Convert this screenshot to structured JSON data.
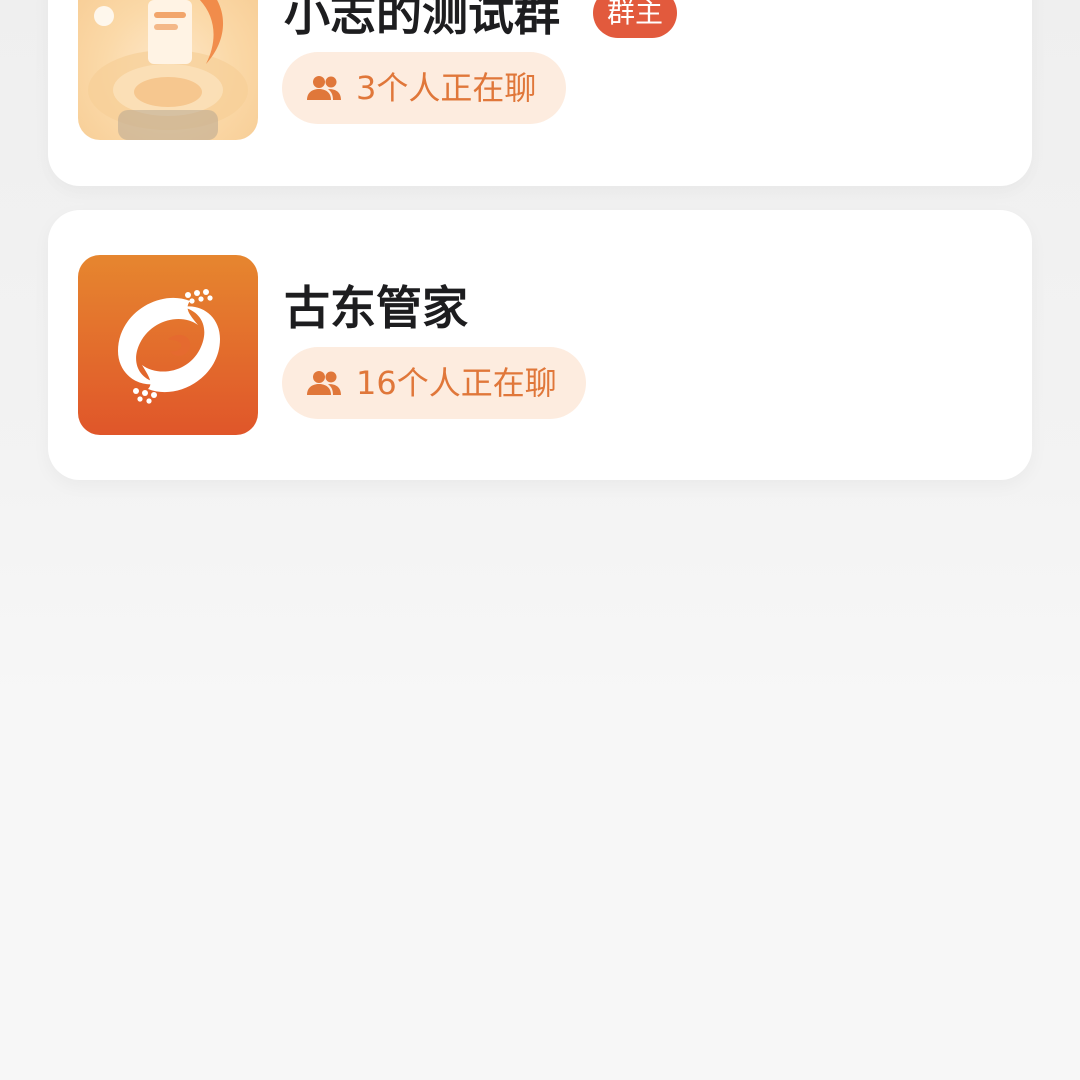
{
  "groups": [
    {
      "name": "小志的测试群",
      "badge": "群主",
      "chat_status": "3个人正在聊",
      "avatar_icon": "illustrated-group-avatar"
    },
    {
      "name": "古东管家",
      "chat_status": "16个人正在聊",
      "avatar_icon": "orange-swirl-logo"
    }
  ],
  "colors": {
    "accent": "#e0773a",
    "badge_bg": "#e25a3d",
    "pill_bg": "#fdecdf",
    "title": "#1d1d1f"
  },
  "icons": {
    "people": "people-icon"
  }
}
